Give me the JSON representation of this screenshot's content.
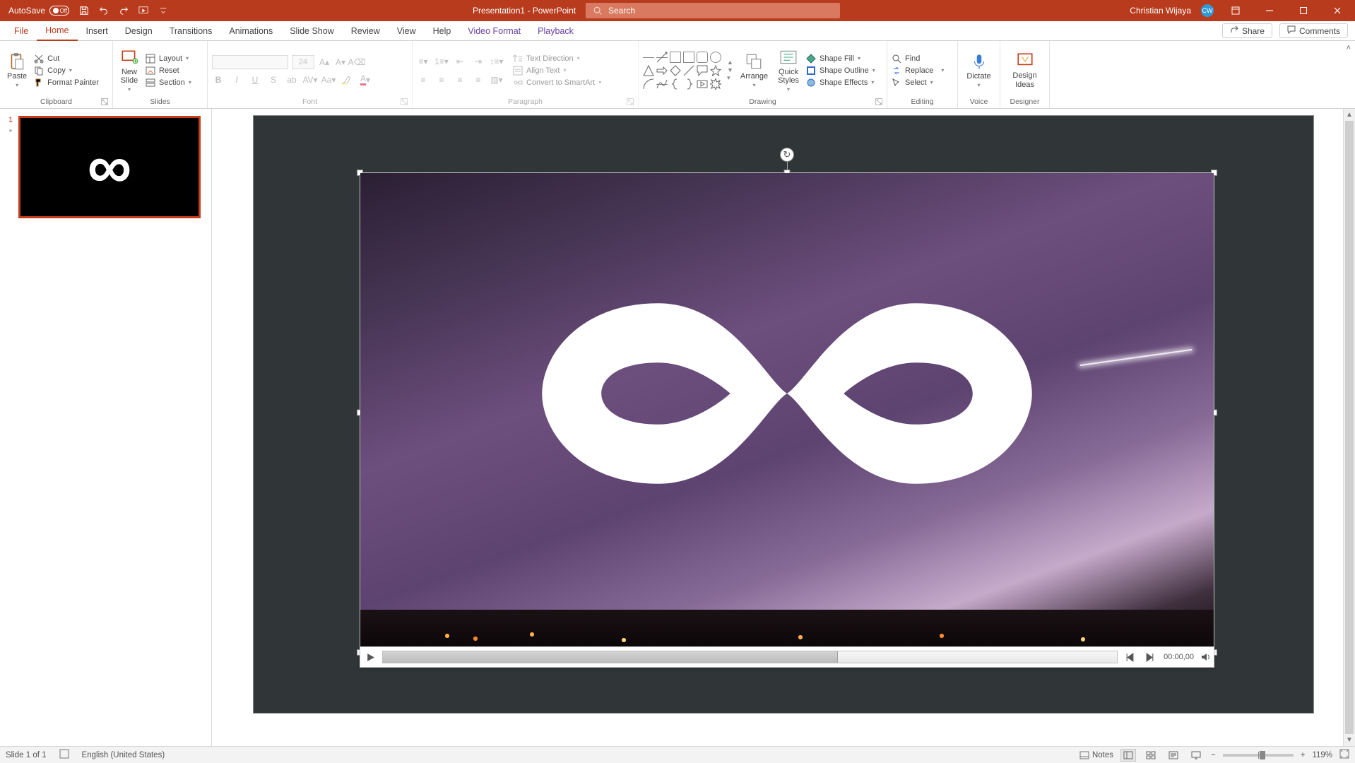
{
  "colors": {
    "accent": "#b83b1d",
    "format_accent": "#6b3fa0"
  },
  "titlebar": {
    "autosave_label": "AutoSave",
    "autosave_state": "Off",
    "doc_title": "Presentation1 - PowerPoint",
    "search_placeholder": "Search",
    "user_name": "Christian Wijaya",
    "user_initials": "CW"
  },
  "tabs": {
    "file": "File",
    "items": [
      "Home",
      "Insert",
      "Design",
      "Transitions",
      "Animations",
      "Slide Show",
      "Review",
      "View",
      "Help"
    ],
    "contextual": [
      "Video Format",
      "Playback"
    ],
    "active": "Home",
    "share": "Share",
    "comments": "Comments"
  },
  "ribbon": {
    "clipboard": {
      "paste": "Paste",
      "cut": "Cut",
      "copy": "Copy",
      "format_painter": "Format Painter",
      "label": "Clipboard"
    },
    "slides": {
      "new_slide": "New\nSlide",
      "layout": "Layout",
      "reset": "Reset",
      "section": "Section",
      "label": "Slides"
    },
    "font": {
      "size_placeholder": "24",
      "label": "Font"
    },
    "paragraph": {
      "text_direction": "Text Direction",
      "align_text": "Align Text",
      "convert_smartart": "Convert to SmartArt",
      "label": "Paragraph"
    },
    "drawing": {
      "arrange": "Arrange",
      "quick_styles": "Quick\nStyles",
      "shape_fill": "Shape Fill",
      "shape_outline": "Shape Outline",
      "shape_effects": "Shape Effects",
      "label": "Drawing"
    },
    "editing": {
      "find": "Find",
      "replace": "Replace",
      "select": "Select",
      "label": "Editing"
    },
    "voice": {
      "dictate": "Dictate",
      "label": "Voice"
    },
    "designer": {
      "design_ideas": "Design\nIdeas",
      "label": "Designer"
    }
  },
  "thumbnail": {
    "number": "1",
    "anim_indicator": "*"
  },
  "video": {
    "timecode": "00:00,00"
  },
  "statusbar": {
    "slide_info": "Slide 1 of 1",
    "language": "English (United States)",
    "notes": "Notes",
    "zoom": "119%"
  }
}
